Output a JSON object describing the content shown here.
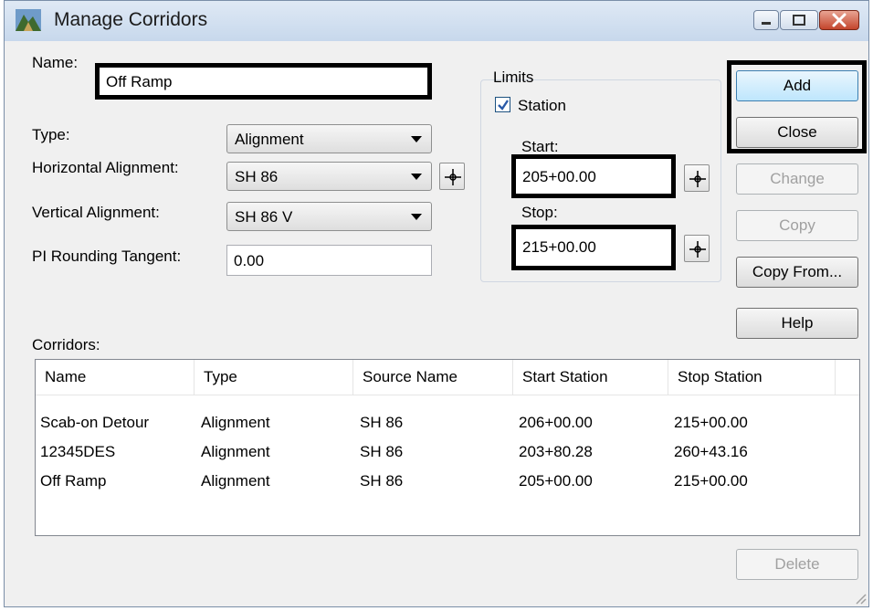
{
  "window": {
    "title": "Manage Corridors"
  },
  "form": {
    "name_label": "Name:",
    "name_value": "Off Ramp",
    "type_label": "Type:",
    "type_value": "Alignment",
    "horizontal_label": "Horizontal Alignment:",
    "horizontal_value": "SH 86",
    "vertical_label": "Vertical Alignment:",
    "vertical_value": "SH 86 V",
    "pi_label": "PI Rounding Tangent:",
    "pi_value": "0.00"
  },
  "limits": {
    "group_label": "Limits",
    "station_label": "Station",
    "station_checked": true,
    "start_label": "Start:",
    "start_value": "205+00.00",
    "stop_label": "Stop:",
    "stop_value": "215+00.00"
  },
  "buttons": {
    "add": "Add",
    "close": "Close",
    "change": "Change",
    "copy": "Copy",
    "copy_from": "Copy From...",
    "help": "Help",
    "delete": "Delete"
  },
  "corridors": {
    "label": "Corridors:",
    "columns": [
      "Name",
      "Type",
      "Source Name",
      "Start Station",
      "Stop Station"
    ],
    "rows": [
      [
        "Scab-on Detour",
        "Alignment",
        "SH 86",
        "206+00.00",
        "215+00.00"
      ],
      [
        "12345DES",
        "Alignment",
        "SH 86",
        "203+80.28",
        "260+43.16"
      ],
      [
        "Off Ramp",
        "Alignment",
        "SH 86",
        "205+00.00",
        "215+00.00"
      ]
    ]
  },
  "colors": {
    "titlebar": "#c7d8ec",
    "default_button": "#bee6fd",
    "close_caption": "#c4452c",
    "highlight_frame": "#000000"
  }
}
